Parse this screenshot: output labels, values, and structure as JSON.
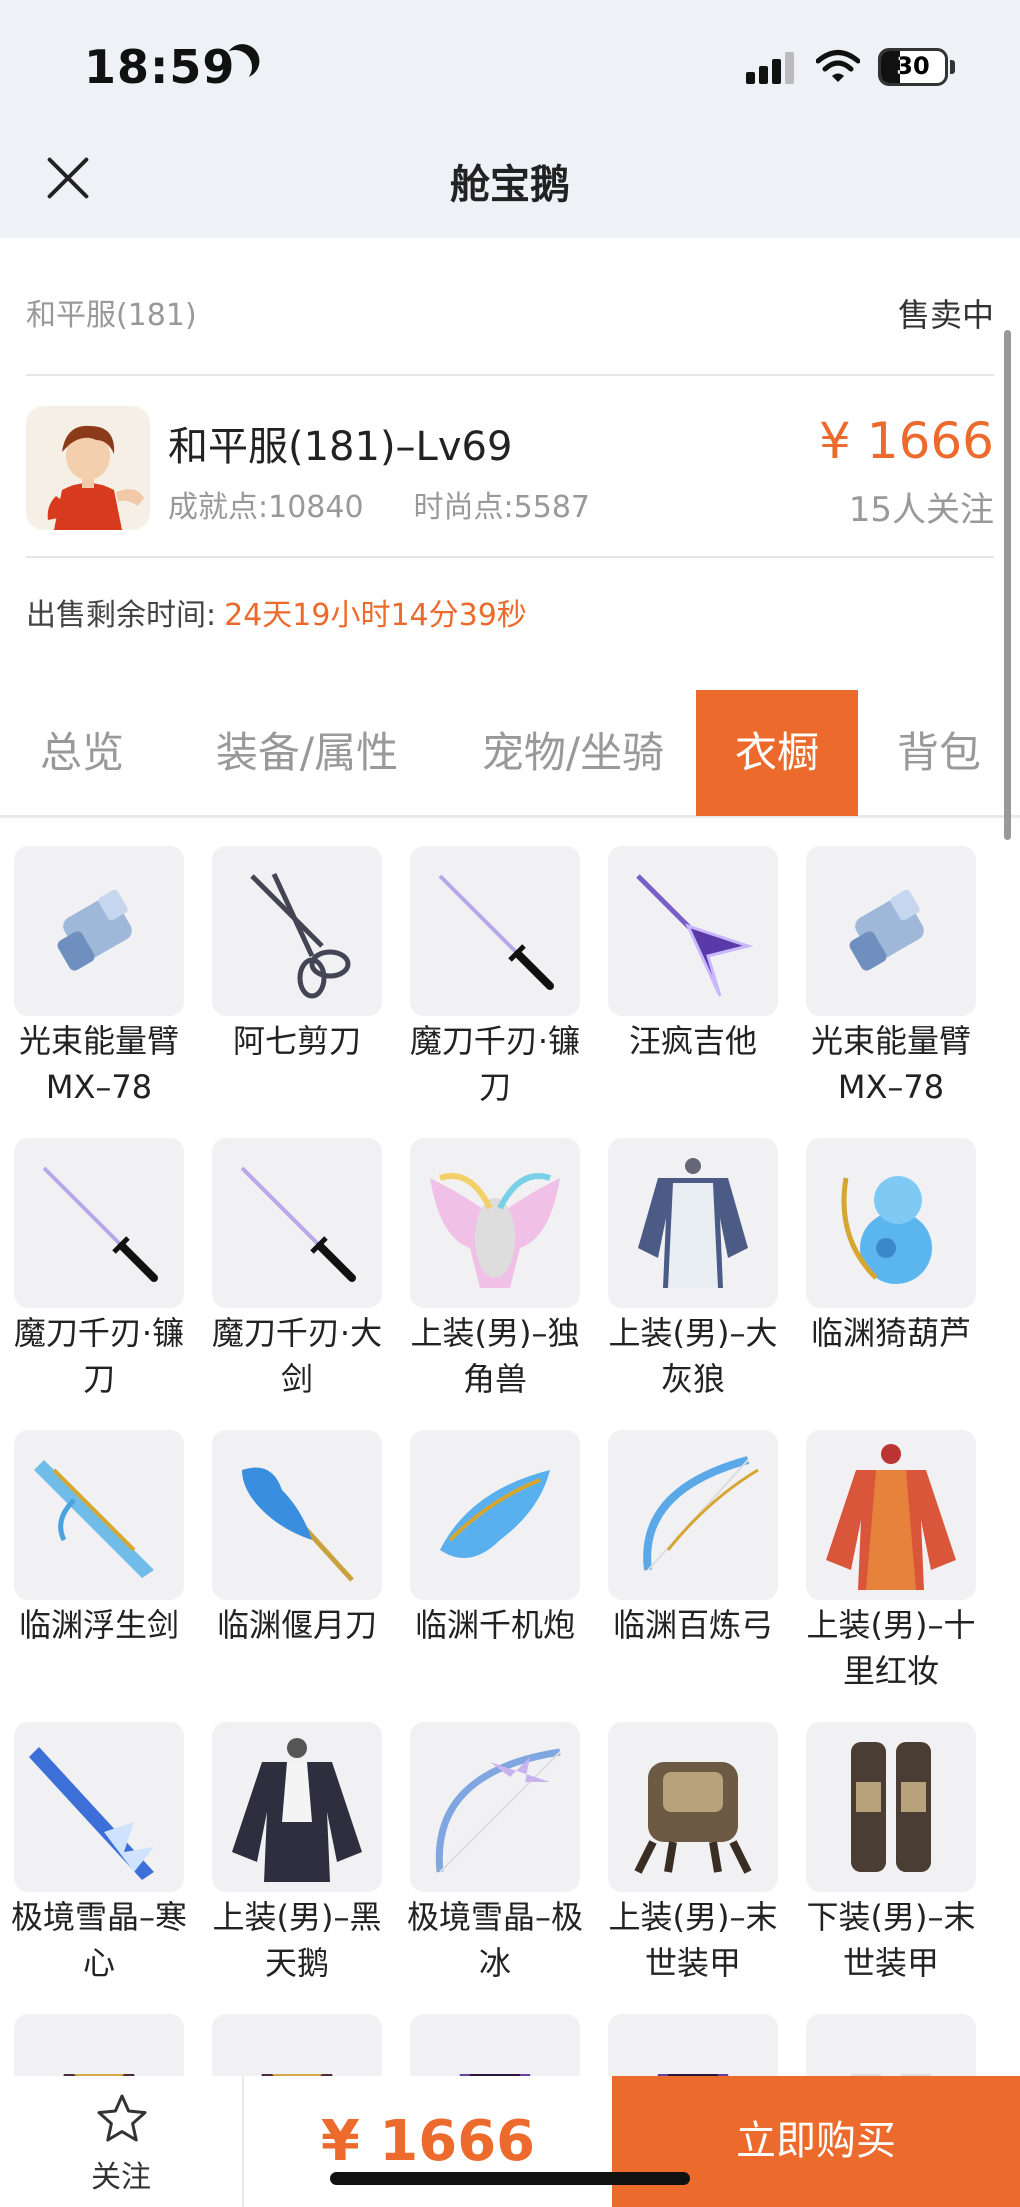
{
  "status_bar": {
    "time": "18:59",
    "battery": "30"
  },
  "nav": {
    "title": "舱宝鹅"
  },
  "listing": {
    "server": "和平服(181)",
    "status": "售卖中",
    "title": "和平服(181)–Lv69",
    "achievement": "成就点:10840",
    "fashion": "时尚点:5587",
    "price": "¥ 1666",
    "followers": "15人关注",
    "remaining_label": "出售剩余时间:",
    "remaining_value": "24天19小时14分39秒"
  },
  "tabs": [
    {
      "label": "总览"
    },
    {
      "label": "装备/属性"
    },
    {
      "label": "宠物/坐骑"
    },
    {
      "label": "衣橱"
    },
    {
      "label": "背包"
    }
  ],
  "active_tab": "衣橱",
  "wardrobe": [
    {
      "name": "光束能量臂MX–78",
      "icon": "energy-arm-icon"
    },
    {
      "name": "阿七剪刀",
      "icon": "scissors-icon"
    },
    {
      "name": "魔刀千刃·镰刀",
      "icon": "katana-icon"
    },
    {
      "name": "汪疯吉他",
      "icon": "guitar-icon"
    },
    {
      "name": "光束能量臂MX–78",
      "icon": "energy-arm-icon"
    },
    {
      "name": "魔刀千刃·镰刀",
      "icon": "katana-icon"
    },
    {
      "name": "魔刀千刃·大剑",
      "icon": "katana-icon"
    },
    {
      "name": "上装(男)–独角兽",
      "icon": "unicorn-outfit-icon"
    },
    {
      "name": "上装(男)–大灰狼",
      "icon": "wolf-outfit-icon"
    },
    {
      "name": "临渊猗葫芦",
      "icon": "gourd-icon"
    },
    {
      "name": "临渊浮生剑",
      "icon": "ice-sword-icon"
    },
    {
      "name": "临渊偃月刀",
      "icon": "glaive-icon"
    },
    {
      "name": "临渊千机炮",
      "icon": "cannon-icon"
    },
    {
      "name": "临渊百炼弓",
      "icon": "bow-icon"
    },
    {
      "name": "上装(男)–十里红妆",
      "icon": "red-robe-icon"
    },
    {
      "name": "极境雪晶–寒心",
      "icon": "crystal-sword-icon"
    },
    {
      "name": "上装(男)–黑天鹅",
      "icon": "black-swan-outfit-icon"
    },
    {
      "name": "极境雪晶–极冰",
      "icon": "crystal-bow-icon"
    },
    {
      "name": "上装(男)–末世装甲",
      "icon": "armor-top-icon"
    },
    {
      "name": "下装(男)–末世装甲",
      "icon": "armor-bottom-icon"
    },
    {
      "name": "",
      "icon": "dark-outfit-icon"
    },
    {
      "name": "",
      "icon": "dark-outfit-icon"
    },
    {
      "name": "",
      "icon": "purple-outfit-icon"
    },
    {
      "name": "",
      "icon": "purple-outfit-icon"
    },
    {
      "name": "",
      "icon": "boots-icon"
    }
  ],
  "bottom": {
    "follow_label": "关注",
    "price": "¥ 1666",
    "buy_label": "立即购买"
  },
  "colors": {
    "accent": "#ec6a2c",
    "muted": "#999999",
    "tile_bg": "#f1f1f3"
  }
}
